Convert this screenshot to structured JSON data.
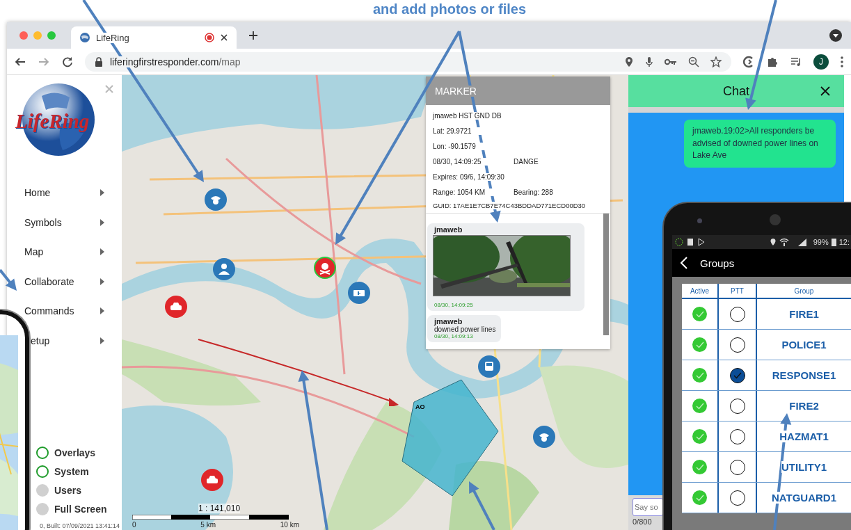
{
  "annotation": {
    "text": "and add photos or files"
  },
  "browser": {
    "tab": {
      "title": "LifeRing"
    },
    "url": {
      "host": "liferingfirstresponder.com",
      "path": "/map"
    },
    "profile_initial": "J"
  },
  "sidebar": {
    "logo_text": "LifeRing",
    "menu": [
      {
        "label": "Home"
      },
      {
        "label": "Symbols"
      },
      {
        "label": "Map"
      },
      {
        "label": "Collaborate"
      },
      {
        "label": "Commands"
      },
      {
        "label": "etup"
      }
    ],
    "toggles": [
      {
        "label": "Overlays",
        "on": true
      },
      {
        "label": "System",
        "on": true
      },
      {
        "label": "Users",
        "on": false
      },
      {
        "label": "Full Screen",
        "on": false
      }
    ],
    "footer": "0, Built: 07/09/2021 13:41:14"
  },
  "map": {
    "scale": "1 : 141,010",
    "scale_labels": [
      "0",
      "5 km",
      "10 km"
    ],
    "shape_label": "AO"
  },
  "marker_popup": {
    "title": "MARKER",
    "lines": [
      {
        "left": "jmaweb HST GND DB"
      },
      {
        "left": "Lat: 29.9721"
      },
      {
        "left": "Lon: -90.1579"
      },
      {
        "left": "08/30, 14:09:25",
        "right": "DANGE"
      },
      {
        "left": "Expires: 09/6, 14:09:30"
      },
      {
        "left": "Range: 1054 KM",
        "right": "Bearing: 288"
      },
      {
        "left": "GUID: 17AE1E7CB7E74C43BDDAD771ECD00D30"
      }
    ],
    "posts": [
      {
        "user": "jmaweb",
        "time": "08/30, 14:09:25"
      },
      {
        "kind": "text",
        "user": "jmaweb",
        "text": "downed power lines",
        "time": "08/30, 14:09:13"
      }
    ]
  },
  "chat": {
    "title": "Chat",
    "messages": [
      {
        "text": "jmaweb.19:02>All responders be advised of downed power lines on Lake Ave"
      }
    ],
    "input": {
      "placeholder": "Say so"
    },
    "counter": "0/800"
  },
  "groups_phone": {
    "battery": "99%",
    "time": "12:",
    "title": "Groups",
    "columns": [
      "Active",
      "PTT",
      "Group"
    ],
    "rows": [
      {
        "active": true,
        "ptt": false,
        "group": "FIRE1"
      },
      {
        "active": true,
        "ptt": false,
        "group": "POLICE1"
      },
      {
        "active": true,
        "ptt": true,
        "group": "RESPONSE1"
      },
      {
        "active": true,
        "ptt": false,
        "group": "FIRE2"
      },
      {
        "active": true,
        "ptt": false,
        "group": "HAZMAT1"
      },
      {
        "active": true,
        "ptt": false,
        "group": "UTILITY1"
      },
      {
        "active": true,
        "ptt": false,
        "group": "NATGUARD1"
      }
    ]
  }
}
